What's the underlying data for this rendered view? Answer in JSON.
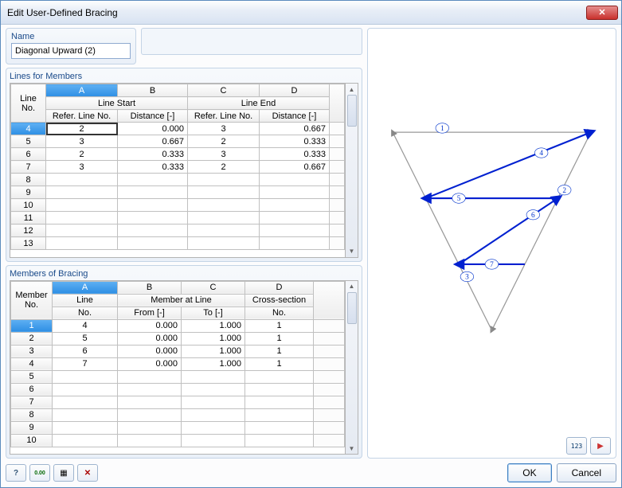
{
  "window": {
    "title": "Edit User-Defined Bracing"
  },
  "name": {
    "label": "Name",
    "value": "Diagonal Upward (2)"
  },
  "linesTable": {
    "title": "Lines for Members",
    "cols": {
      "A": "A",
      "B": "B",
      "C": "C",
      "D": "D"
    },
    "hdr": {
      "lineNo": "Line No.",
      "lineStart": "Line Start",
      "lineEnd": "Line End",
      "referLine": "Refer. Line No.",
      "distance": "Distance [-]"
    },
    "rows": [
      {
        "no": "4",
        "a": "2",
        "b": "0.000",
        "c": "3",
        "d": "0.667"
      },
      {
        "no": "5",
        "a": "3",
        "b": "0.667",
        "c": "2",
        "d": "0.333"
      },
      {
        "no": "6",
        "a": "2",
        "b": "0.333",
        "c": "3",
        "d": "0.333"
      },
      {
        "no": "7",
        "a": "3",
        "b": "0.333",
        "c": "2",
        "d": "0.667"
      }
    ],
    "emptyRows": [
      "8",
      "9",
      "10",
      "11",
      "12",
      "13"
    ]
  },
  "membersTable": {
    "title": "Members of Bracing",
    "cols": {
      "A": "A",
      "B": "B",
      "C": "C",
      "D": "D"
    },
    "hdr": {
      "memberNo": "Member No.",
      "lineNo": "Line No.",
      "memberAtLine": "Member at Line",
      "from": "From [-]",
      "to": "To [-]",
      "crossSection": "Cross-section",
      "csNo": "No."
    },
    "rows": [
      {
        "no": "1",
        "a": "4",
        "b": "0.000",
        "c": "1.000",
        "d": "1"
      },
      {
        "no": "2",
        "a": "5",
        "b": "0.000",
        "c": "1.000",
        "d": "1"
      },
      {
        "no": "3",
        "a": "6",
        "b": "0.000",
        "c": "1.000",
        "d": "1"
      },
      {
        "no": "4",
        "a": "7",
        "b": "0.000",
        "c": "1.000",
        "d": "1"
      }
    ],
    "emptyRows": [
      "5",
      "6",
      "7",
      "8",
      "9",
      "10"
    ]
  },
  "previewLabels": {
    "1": "1",
    "2": "2",
    "3": "3",
    "4": "4",
    "5": "5",
    "6": "6",
    "7": "7"
  },
  "buttons": {
    "ok": "OK",
    "cancel": "Cancel"
  },
  "icons": {
    "help": "help-icon",
    "units": "units-icon",
    "calc": "calc-icon",
    "delete": "delete-icon",
    "values": "values-icon",
    "play": "play-icon"
  }
}
